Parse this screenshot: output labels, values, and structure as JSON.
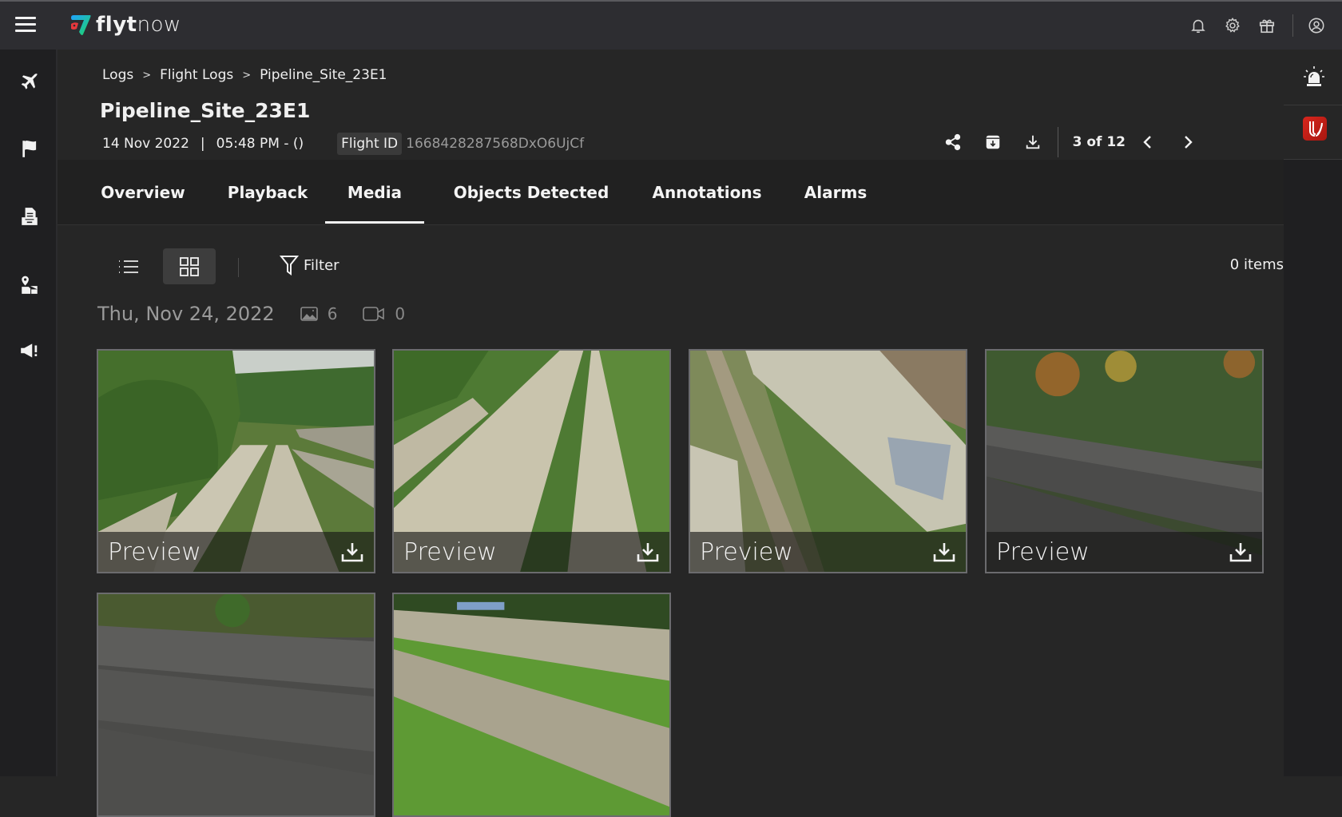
{
  "app": {
    "brand_prefix": "flyt",
    "brand_suffix": "now"
  },
  "topbar": {
    "icons": [
      "notification-bell-icon",
      "settings-gear-icon",
      "gift-icon",
      "user-account-icon"
    ]
  },
  "left_nav": {
    "items": [
      {
        "icon": "airplane-icon",
        "label": "Flights"
      },
      {
        "icon": "flag-icon",
        "label": "Missions"
      },
      {
        "icon": "document-tray-icon",
        "label": "Logs"
      },
      {
        "icon": "map-location-icon",
        "label": "Sites"
      },
      {
        "icon": "megaphone-alert-icon",
        "label": "Alerts"
      }
    ]
  },
  "right_rail": {
    "items": [
      "siren-alarm-icon",
      "integration-app-icon"
    ]
  },
  "breadcrumb": {
    "items": [
      "Logs",
      "Flight Logs",
      "Pipeline_Site_23E1"
    ],
    "separator": ">"
  },
  "page": {
    "title": "Pipeline_Site_23E1",
    "date": "14 Nov 2022",
    "time": "05:48 PM -  ()",
    "flight_id_label": "Flight ID",
    "flight_id_value": "1668428287568DxO6UjCf",
    "counter": "3 of 12"
  },
  "tabs": [
    {
      "label": "Overview",
      "active": false
    },
    {
      "label": "Playback",
      "active": false
    },
    {
      "label": "Media",
      "active": true
    },
    {
      "label": "Objects Detected",
      "active": false
    },
    {
      "label": "Annotations",
      "active": false
    },
    {
      "label": "Alarms",
      "active": false
    }
  ],
  "toolbar": {
    "view_modes": [
      "list",
      "grid"
    ],
    "active_view": "grid",
    "filter_label": "Filter",
    "items_count": "0 items"
  },
  "media_group": {
    "date": "Thu, Nov 24, 2022",
    "image_count": "6",
    "video_count": "0"
  },
  "media_items": [
    {
      "label": "Preview",
      "scene": "twin beige pipelines through green vegetation"
    },
    {
      "label": "Preview",
      "scene": "close-up beige pipelines in grass"
    },
    {
      "label": "Preview",
      "scene": "elevated pipeline with graffiti beside dirt track"
    },
    {
      "label": "Preview",
      "scene": "dark corrugated pipelines by autumn forest"
    },
    {
      "label": "",
      "scene": "dark corrugated pipelines close-up"
    },
    {
      "label": "",
      "scene": "beige pipelines on green grass"
    }
  ],
  "colors": {
    "topbar_bg": "#2d2d31",
    "sidebar_bg": "#1f1f21",
    "main_bg": "#262626",
    "tabs_bg": "#212121",
    "card_border": "#6b6b6e",
    "app_red": "#d8261d",
    "logo_blue": "#1fa2ff",
    "logo_green": "#1ed760",
    "logo_red": "#e8383d"
  }
}
